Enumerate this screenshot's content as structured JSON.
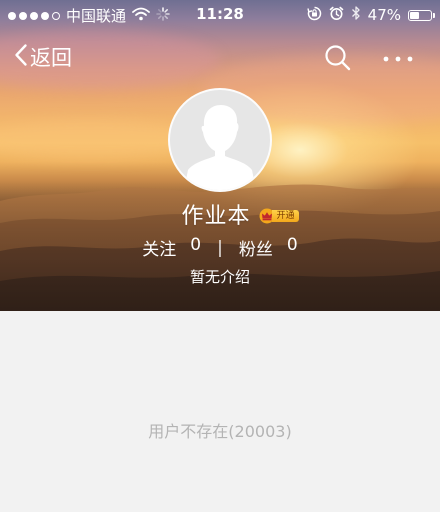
{
  "status_bar": {
    "carrier": "中国联通",
    "time": "11:28",
    "battery_text": "47%",
    "battery_level": 0.47,
    "signal_bars_filled": 4,
    "signal_bars_total": 5
  },
  "nav": {
    "back_label": "返回"
  },
  "profile": {
    "username": "作业本",
    "vip_badge": "开通",
    "following_label": "关注",
    "following_count": "0",
    "separator": "|",
    "followers_label": "粉丝",
    "followers_count": "0",
    "bio": "暂无介绍"
  },
  "content": {
    "empty_message": "用户不存在(20003)"
  },
  "colors": {
    "page_background": "#f2f2f2",
    "empty_text": "#b4b4b4",
    "badge_gold": "#f3a81c"
  },
  "icons": {
    "back": "chevron-left-icon",
    "search": "search-icon",
    "more": "more-dots-icon",
    "wifi": "wifi-icon",
    "loading": "loading-spinner-icon",
    "rotation_lock": "rotation-lock-icon",
    "alarm": "alarm-icon",
    "bluetooth": "bluetooth-icon",
    "crown": "crown-icon"
  }
}
